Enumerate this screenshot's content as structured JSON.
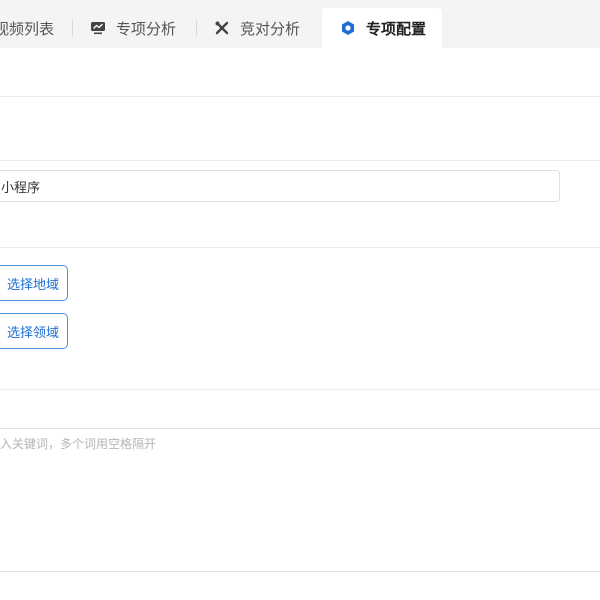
{
  "tabs": [
    {
      "label": "视频列表",
      "icon": "video-list-icon",
      "active": false
    },
    {
      "label": "专项分析",
      "icon": "monitor-chart-icon",
      "active": false
    },
    {
      "label": "竞对分析",
      "icon": "crossed-tools-icon",
      "active": false
    },
    {
      "label": "专项配置",
      "icon": "gear-icon",
      "active": true
    }
  ],
  "form": {
    "name_value": "小程序",
    "region_button": "选择地域",
    "field_button": "选择领域",
    "keywords_placeholder": "入关键词，多个词用空格隔开"
  },
  "colors": {
    "accent": "#1d6fd6",
    "tabbar_bg": "#f3f4f6"
  }
}
